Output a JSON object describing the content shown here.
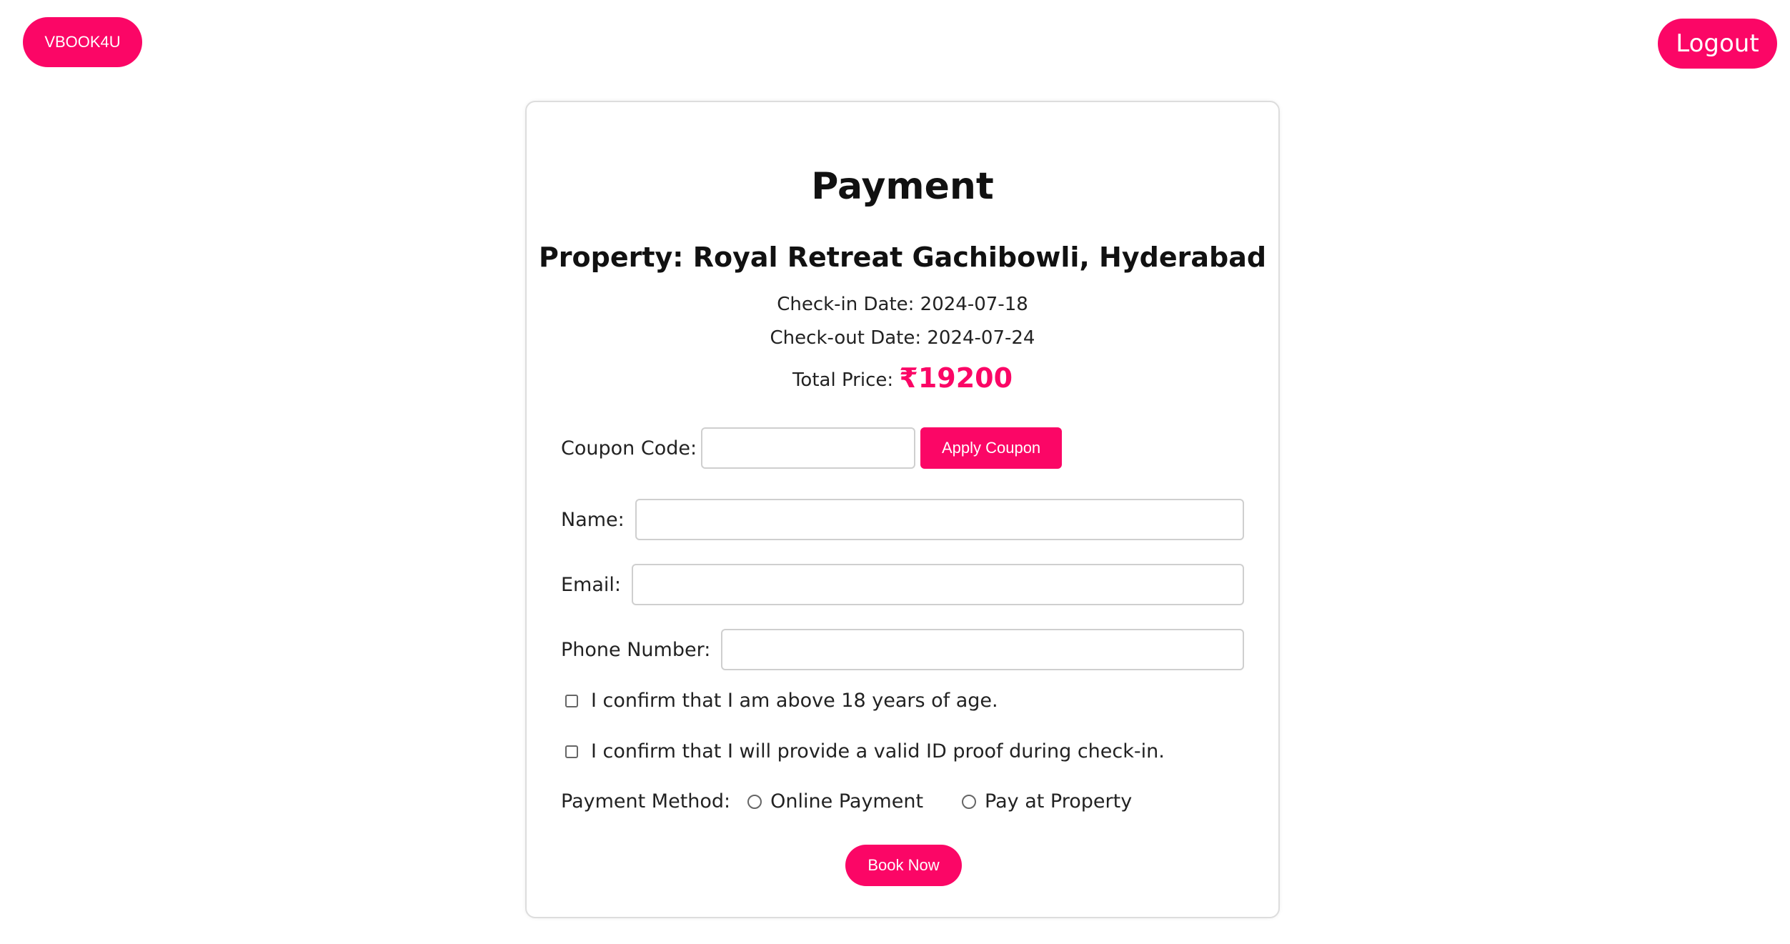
{
  "header": {
    "brand_label": "VBOOK4U",
    "logout_label": "Logout"
  },
  "payment": {
    "title": "Payment",
    "property": "Property: Royal Retreat Gachibowli, Hyderabad",
    "checkin": "Check-in Date: 2024-07-18",
    "checkout": "Check-out Date: 2024-07-24",
    "total_label": "Total Price:",
    "total_value": "₹19200"
  },
  "form": {
    "coupon_label": "Coupon Code:",
    "coupon_value": "",
    "apply_label": "Apply Coupon",
    "name_label": "Name:",
    "name_value": "",
    "email_label": "Email:",
    "email_value": "",
    "phone_label": "Phone Number:",
    "phone_value": "",
    "confirm_age": "I confirm that I am above 18 years of age.",
    "confirm_id": "I confirm that I will provide a valid ID proof during check-in.",
    "payment_method_label": "Payment Method:",
    "payment_options": [
      "Online Payment",
      "Pay at Property"
    ],
    "book_label": "Book Now"
  },
  "colors": {
    "accent": "#fb0666"
  }
}
